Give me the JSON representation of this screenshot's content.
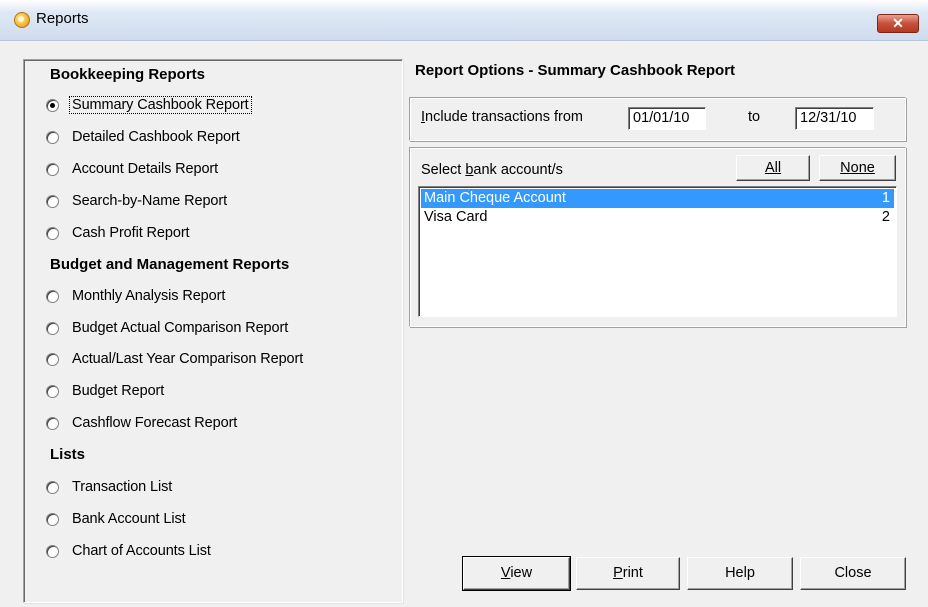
{
  "window": {
    "title": "Reports"
  },
  "left_panel": {
    "sections": [
      {
        "title": "Bookkeeping Reports",
        "items": [
          {
            "label": "Summary Cashbook Report",
            "checked": true
          },
          {
            "label": "Detailed Cashbook Report",
            "checked": false
          },
          {
            "label": "Account Details Report",
            "checked": false
          },
          {
            "label": "Search-by-Name Report",
            "checked": false
          },
          {
            "label": "Cash Profit Report",
            "checked": false
          }
        ]
      },
      {
        "title": "Budget and Management Reports",
        "items": [
          {
            "label": "Monthly Analysis Report",
            "checked": false
          },
          {
            "label": "Budget Actual Comparison Report",
            "checked": false
          },
          {
            "label": "Actual/Last Year Comparison Report",
            "checked": false
          },
          {
            "label": "Budget Report",
            "checked": false
          },
          {
            "label": "Cashflow Forecast Report",
            "checked": false
          }
        ]
      },
      {
        "title": "Lists",
        "items": [
          {
            "label": "Transaction List",
            "checked": false
          },
          {
            "label": "Bank Account List",
            "checked": false
          },
          {
            "label": "Chart of Accounts List",
            "checked": false
          }
        ]
      }
    ]
  },
  "options": {
    "title": "Report Options - Summary Cashbook Report",
    "date_range": {
      "label_mnemonic": "I",
      "label_rest": "nclude transactions from",
      "from_value": "01/01/10",
      "to_label": "to",
      "to_value": "12/31/10"
    },
    "bank_accounts": {
      "label_before": "Select ",
      "label_mnemonic": "b",
      "label_after": "ank account/s",
      "all_button": "All",
      "none_button": "None",
      "accounts": [
        {
          "name": "Main Cheque Account",
          "number": "1",
          "selected": true
        },
        {
          "name": "Visa Card",
          "number": "2",
          "selected": false
        }
      ]
    }
  },
  "buttons": {
    "view": {
      "mnemonic": "V",
      "rest": "iew"
    },
    "print": {
      "mnemonic": "P",
      "rest": "rint"
    },
    "help": "Help",
    "close": "Close"
  },
  "colors": {
    "selection": "#3399ff",
    "dialog_bg": "#f0f0f0",
    "close_button": "#c9503a"
  }
}
